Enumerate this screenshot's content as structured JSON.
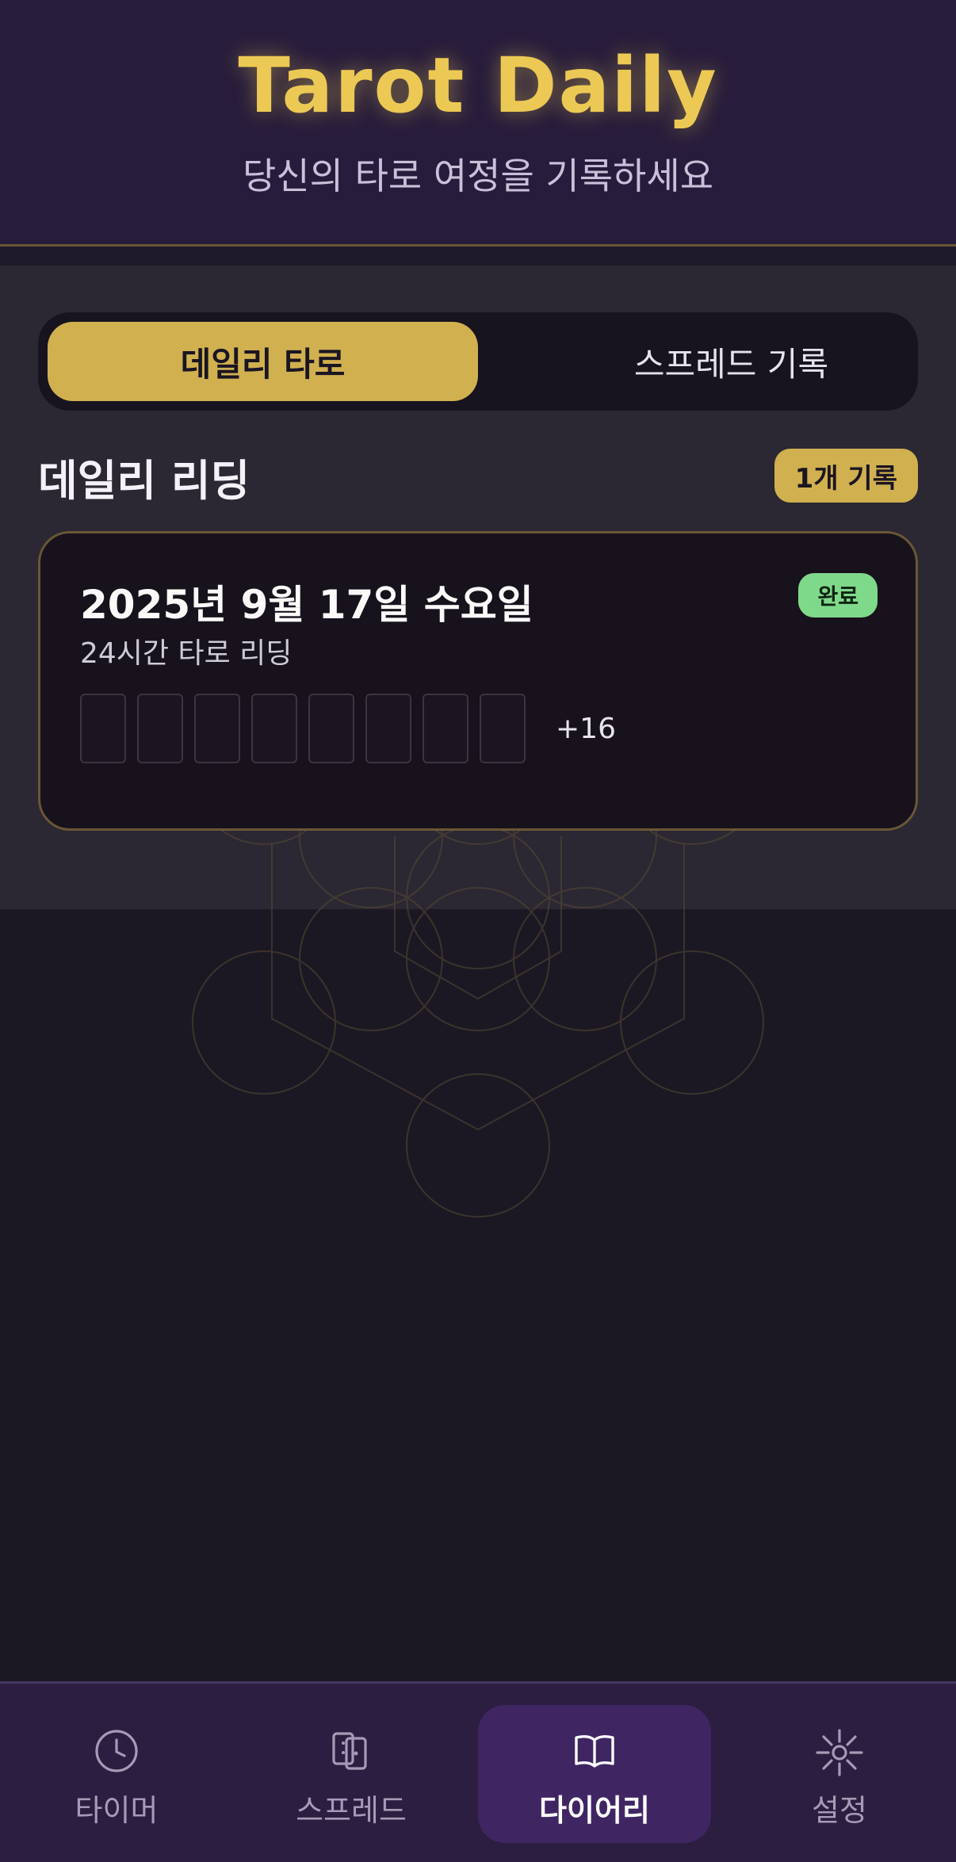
{
  "header": {
    "title": "Tarot Daily",
    "subtitle": "당신의 타로 여정을 기록하세요"
  },
  "tabs": [
    {
      "label": "데일리 타로",
      "active": true
    },
    {
      "label": "스프레드 기록",
      "active": false
    }
  ],
  "section": {
    "title": "데일리 리딩",
    "count_badge": "1개 기록"
  },
  "entry": {
    "date": "2025년 9월 17일 수요일",
    "subtitle": "24시간 타로 리딩",
    "status": "완료",
    "more_count": "+16"
  },
  "nav": {
    "items": [
      {
        "label": "타이머",
        "icon": "clock-icon",
        "active": false
      },
      {
        "label": "스프레드",
        "icon": "cards-icon",
        "active": false
      },
      {
        "label": "다이어리",
        "icon": "book-icon",
        "active": true
      },
      {
        "label": "설정",
        "icon": "sun-icon",
        "active": false
      }
    ]
  },
  "colors": {
    "accent_gold": "#d1b050",
    "title_gold": "#ecc954",
    "done_green": "#7fd98a",
    "nav_active": "#3f2663"
  }
}
